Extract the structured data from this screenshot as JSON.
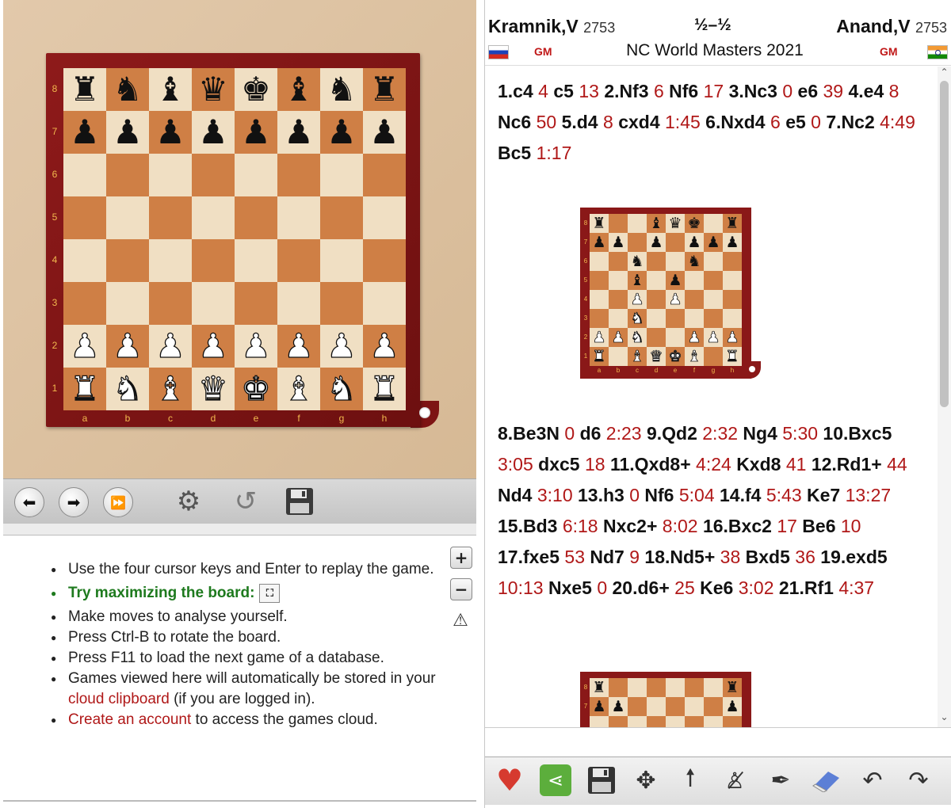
{
  "board": {
    "ranks": [
      "8",
      "7",
      "6",
      "5",
      "4",
      "3",
      "2",
      "1"
    ],
    "files": [
      "a",
      "b",
      "c",
      "d",
      "e",
      "f",
      "g",
      "h"
    ],
    "position": [
      "rnbqkbnr",
      "pppppppp",
      "........",
      "........",
      "........",
      "........",
      "PPPPPPPP",
      "RNBQKBNR"
    ]
  },
  "nav": {
    "back_icon": "arrow-left-icon",
    "forward_icon": "arrow-right-icon",
    "end_icon": "fast-forward-icon",
    "engine_icon": "engine-wheel-icon",
    "rotate_icon": "rotate-icon",
    "save_icon": "floppy-disk-icon"
  },
  "info": {
    "item1": "Use the four cursor keys and Enter to replay the game.",
    "tip": "Try maximizing the board:",
    "item3": "Make moves to analyse yourself.",
    "item4": "Press Ctrl-B to rotate the board.",
    "item5": "Press F11 to load the next game of a database.",
    "item6_pre": "Games viewed here will automatically be stored in your ",
    "item6_link": "cloud clipboard",
    "item6_post": " (if you are logged in).",
    "item7_link": "Create an account",
    "item7_post": " to access the games cloud."
  },
  "header": {
    "white_name": "Kramnik,V",
    "white_elo": "2753",
    "white_title": "GM",
    "result": "½–½",
    "black_name": "Anand,V",
    "black_elo": "2753",
    "black_title": "GM",
    "event": "NC World Masters 2021"
  },
  "moves_part1": [
    {
      "m": "1.c4",
      "t": "4"
    },
    {
      "m": "c5",
      "t": "13"
    },
    {
      "m": "2.Nf3",
      "t": "6"
    },
    {
      "m": "Nf6",
      "t": "17"
    },
    {
      "m": "3.Nc3",
      "t": "0"
    },
    {
      "m": "e6",
      "t": "39"
    },
    {
      "m": "4.e4",
      "t": "8"
    },
    {
      "m": "Nc6",
      "t": "50"
    },
    {
      "m": "5.d4",
      "t": "8"
    },
    {
      "m": "cxd4",
      "t": "1:45"
    },
    {
      "m": "6.Nxd4",
      "t": "6"
    },
    {
      "m": "e5",
      "t": "0"
    },
    {
      "m": "7.Nc2",
      "t": "4:49"
    },
    {
      "m": "Bc5",
      "t": "1:17"
    }
  ],
  "moves_part2": [
    {
      "m": "8.Be3N",
      "t": "0"
    },
    {
      "m": "d6",
      "t": "2:23"
    },
    {
      "m": "9.Qd2",
      "t": "2:32"
    },
    {
      "m": "Ng4",
      "t": "5:30"
    },
    {
      "m": "10.Bxc5",
      "t": "3:05"
    },
    {
      "m": "dxc5",
      "t": "18"
    },
    {
      "m": "11.Qxd8+",
      "t": "4:24"
    },
    {
      "m": "Kxd8",
      "t": "41"
    },
    {
      "m": "12.Rd1+",
      "t": "44"
    },
    {
      "m": "Nd4",
      "t": "3:10"
    },
    {
      "m": "13.h3",
      "t": "0"
    },
    {
      "m": "Nf6",
      "t": "5:04"
    },
    {
      "m": "14.f4",
      "t": "5:43"
    },
    {
      "m": "Ke7",
      "t": "13:27"
    },
    {
      "m": "15.Bd3",
      "t": "6:18"
    },
    {
      "m": "Nxc2+",
      "t": "8:02"
    },
    {
      "m": "16.Bxc2",
      "t": "17"
    },
    {
      "m": "Be6",
      "t": "10"
    },
    {
      "m": "17.fxe5",
      "t": "53"
    },
    {
      "m": "Nd7",
      "t": "9"
    },
    {
      "m": "18.Nd5+",
      "t": "38"
    },
    {
      "m": "Bxd5",
      "t": "36"
    },
    {
      "m": "19.exd5",
      "t": "10:13"
    },
    {
      "m": "Nxe5",
      "t": "0"
    },
    {
      "m": "20.d6+",
      "t": "25"
    },
    {
      "m": "Ke6",
      "t": "3:02"
    },
    {
      "m": "21.Rf1",
      "t": "4:37"
    }
  ],
  "diagram1": [
    "r..bqk.r",
    "pp.p.ppp",
    "..n..n..",
    "..b.p...",
    "..P.P...",
    "..N.....",
    "PPN..PPP",
    "R.BQKB.R"
  ],
  "diagram2": [
    "r......r",
    "pp.....p",
    "........",
    "........",
    "........",
    "........",
    "........",
    "........"
  ],
  "toolbar": {
    "icons": [
      "heart-icon",
      "share-icon",
      "save-icon",
      "move-icon",
      "up-arrow-icon",
      "delete-piece-icon",
      "pen-icon",
      "eraser-icon",
      "undo-icon",
      "redo-icon"
    ]
  },
  "colors": {
    "board_frame": "#8e1a1a",
    "light_square": "#f0dfc3",
    "dark_square": "#cf7f45",
    "time_red": "#b01818",
    "tip_green": "#1e7a1e"
  }
}
